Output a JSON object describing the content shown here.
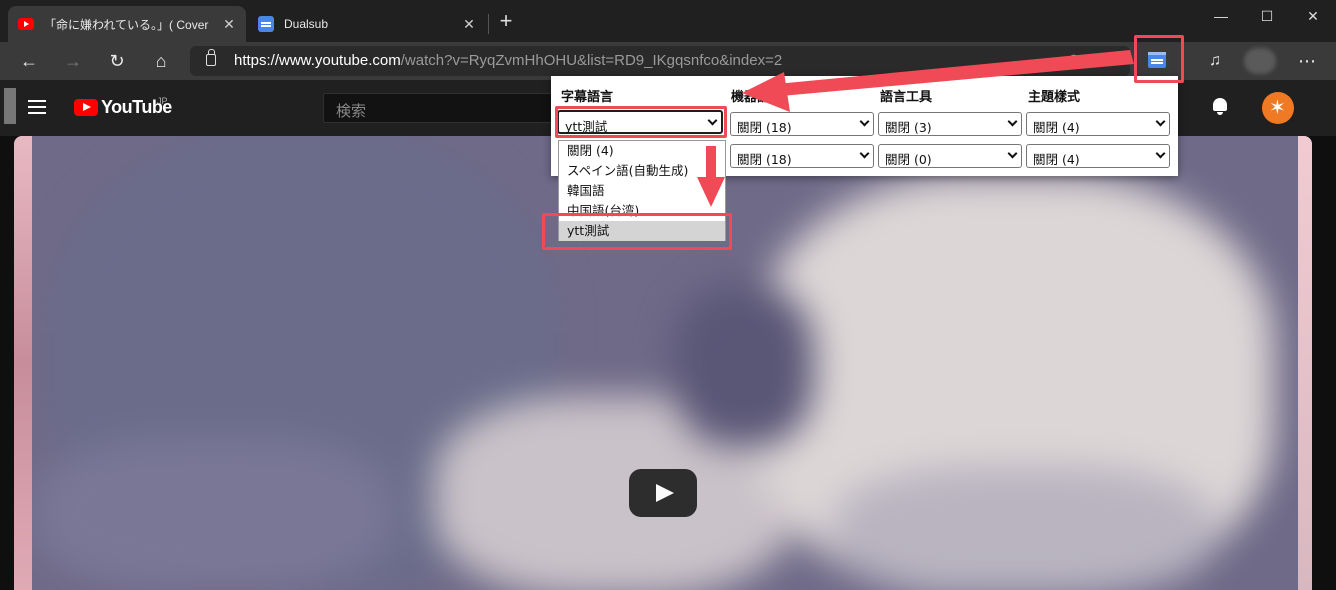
{
  "browser": {
    "tabs": [
      {
        "title": "「命に嫌われている。」( Cover",
        "active": true
      },
      {
        "title": "Dualsub",
        "active": false
      }
    ],
    "url_host": "https://www.youtube.com",
    "url_path": "/watch?v=RyqZvmHhOHU&list=RD9_IKgqsnfco&index=2",
    "window_controls": {
      "minimize": "—",
      "maximize": "☐",
      "close": "✕"
    }
  },
  "youtube": {
    "brand": "YouTube",
    "region": "JP",
    "search_placeholder": "検索"
  },
  "popup": {
    "columns": [
      {
        "label": "字幕語言",
        "row1": "ytt測試",
        "row2": ""
      },
      {
        "label": "機器翻譯",
        "row1": "關閉 (18)",
        "row2": "關閉 (18)"
      },
      {
        "label": "語言工具",
        "row1": "關閉 (3)",
        "row2": "關閉 (0)"
      },
      {
        "label": "主題樣式",
        "row1": "關閉 (4)",
        "row2": "關閉 (4)"
      }
    ],
    "dropdown_options": [
      "關閉 (4)",
      "スペイン語(自動生成)",
      "韓国語",
      "中国語(台湾)",
      "ytt測試"
    ],
    "dropdown_selected_index": 4
  },
  "colors": {
    "annotation_red": "#f04a56",
    "extension_blue": "#4a86e8",
    "youtube_red": "#ff0000"
  }
}
